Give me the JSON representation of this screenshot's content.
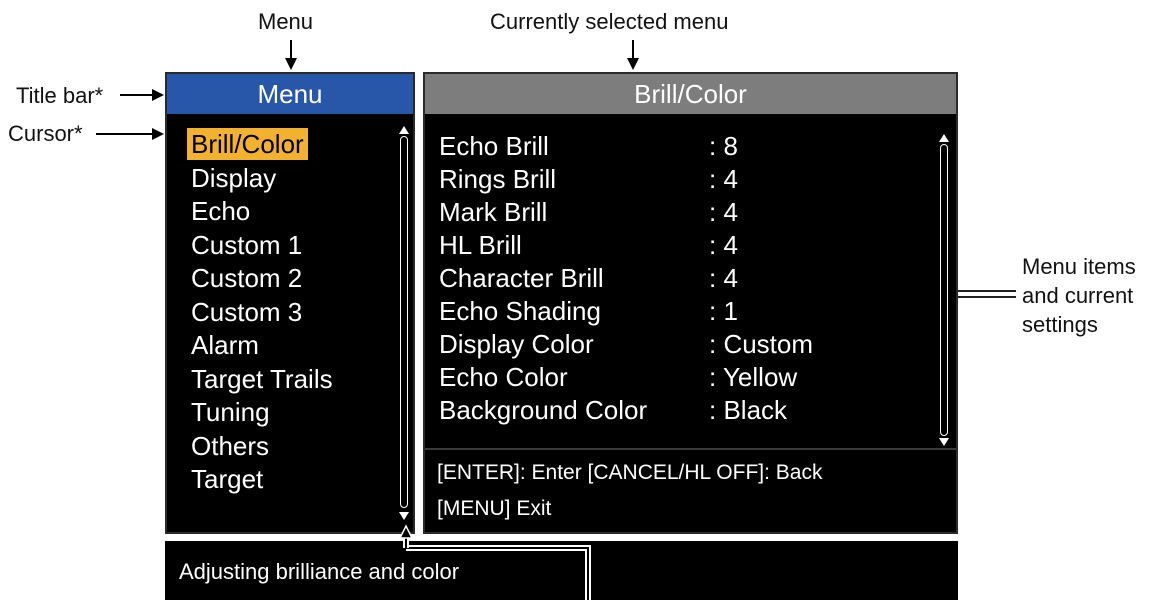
{
  "annotations": {
    "menu": "Menu",
    "current_menu": "Currently selected menu",
    "title_bar": "Title bar*",
    "cursor": "Cursor*",
    "menu_items_line1": "Menu items",
    "menu_items_line2": "and current",
    "menu_items_line3": "settings"
  },
  "menu_panel": {
    "title": "Menu",
    "items": [
      "Brill/Color",
      "Display",
      "Echo",
      "Custom 1",
      "Custom 2",
      "Custom 3",
      "Alarm",
      "Target Trails",
      "Tuning",
      "Others",
      "Target"
    ],
    "selected_index": 0
  },
  "settings_panel": {
    "title": "Brill/Color",
    "rows": [
      {
        "label": "Echo Brill",
        "value": ": 8"
      },
      {
        "label": "Rings Brill",
        "value": ": 4"
      },
      {
        "label": "Mark Brill",
        "value": ": 4"
      },
      {
        "label": "HL Brill",
        "value": ": 4"
      },
      {
        "label": "Character Brill",
        "value": ": 4"
      },
      {
        "label": "Echo Shading",
        "value": ": 1"
      },
      {
        "label": "Display Color",
        "value": ": Custom"
      },
      {
        "label": "Echo Color",
        "value": ": Yellow"
      },
      {
        "label": "Background Color",
        "value": ": Black"
      }
    ],
    "help_line1": "[ENTER]: Enter [CANCEL/HL OFF]: Back",
    "help_line2": "[MENU] Exit"
  },
  "guidance": {
    "text": "Adjusting brilliance and color"
  },
  "colors": {
    "menu_title_bg": "#2856a8",
    "settings_title_bg": "#7d7d7d",
    "cursor_highlight": "#f2b12f",
    "panel_bg": "#000000"
  }
}
